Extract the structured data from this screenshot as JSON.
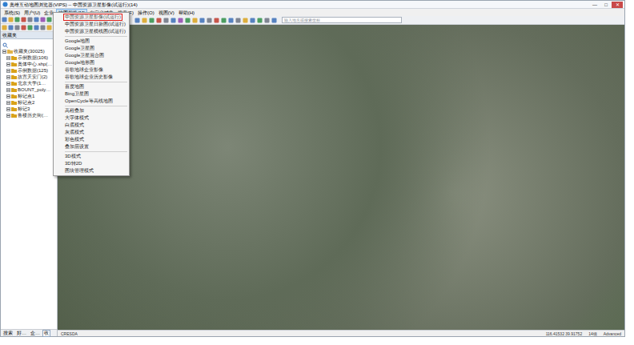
{
  "window": {
    "title": "奥维互动地图浏览器(VIPS) -- 中国资源卫星影像(试运行)(14)",
    "controls": [
      "—",
      "□",
      "✕"
    ]
  },
  "menu_bar": [
    {
      "label": "系统(S)",
      "selected": false
    },
    {
      "label": "用户(U)",
      "selected": false
    },
    {
      "label": "企业",
      "selected": false
    },
    {
      "label": "地图切换(M)",
      "selected": true
    },
    {
      "label": "自定义对象",
      "selected": false
    },
    {
      "label": "搜索(F)",
      "selected": false
    },
    {
      "label": "操作(O)",
      "selected": false
    },
    {
      "label": "视图(V)",
      "selected": false
    },
    {
      "label": "帮助(H)",
      "selected": false
    }
  ],
  "search": {
    "placeholder": "输入地名或搜索坐标"
  },
  "sidebar": {
    "header": "收藏夹",
    "items": [
      {
        "label": "收藏夹(30025)",
        "level": 0,
        "expanded": true
      },
      {
        "label": "示例数据(106)",
        "level": 1,
        "expanded": false
      },
      {
        "label": "奥体中心.shp(…",
        "level": 1,
        "expanded": false
      },
      {
        "label": "示例数据(125)",
        "level": 1,
        "expanded": false
      },
      {
        "label": "故宫天安门(2)",
        "level": 1,
        "expanded": false
      },
      {
        "label": "北京大学(1…",
        "level": 1,
        "expanded": false
      },
      {
        "label": "BOUNT_poly…",
        "level": 1,
        "expanded": false
      },
      {
        "label": "标记点1",
        "level": 1,
        "expanded": false
      },
      {
        "label": "标记点2",
        "level": 1,
        "expanded": false
      },
      {
        "label": "标记3",
        "level": 1,
        "expanded": false
      },
      {
        "label": "鲁楼历史街(…",
        "level": 1,
        "expanded": false
      }
    ],
    "bottom_tabs": [
      {
        "label": "搜索",
        "selected": false
      },
      {
        "label": "好…",
        "selected": false
      },
      {
        "label": "企…",
        "selected": false
      },
      {
        "label": "收",
        "selected": true
      }
    ]
  },
  "dropdown": [
    {
      "kind": "item",
      "label": "中国资源卫星影像(试运行)",
      "selected": true
    },
    {
      "kind": "item",
      "label": "中国资源卫星日新图(试运行)",
      "selected": false
    },
    {
      "kind": "item",
      "label": "中国资源卫星横线图(试运行)",
      "selected": false
    },
    {
      "kind": "separator",
      "label": "",
      "selected": false
    },
    {
      "kind": "item",
      "label": "Google地图",
      "selected": false
    },
    {
      "kind": "item",
      "label": "Google卫星图",
      "selected": false
    },
    {
      "kind": "item",
      "label": "Google卫星混合图",
      "selected": false
    },
    {
      "kind": "item",
      "label": "Google地形图",
      "selected": false
    },
    {
      "kind": "item",
      "label": "谷歌地球企业影像",
      "selected": false
    },
    {
      "kind": "item",
      "label": "谷歌地球企业历史影像",
      "selected": false
    },
    {
      "kind": "separator",
      "label": "",
      "selected": false
    },
    {
      "kind": "item",
      "label": "百度地图",
      "selected": false
    },
    {
      "kind": "item",
      "label": "Bing卫星图",
      "selected": false
    },
    {
      "kind": "item",
      "label": "OpenCycle等高线地图",
      "selected": false
    },
    {
      "kind": "separator",
      "label": "",
      "selected": false
    },
    {
      "kind": "item",
      "label": "高程叠加",
      "selected": false
    },
    {
      "kind": "item",
      "label": "大字体模式",
      "selected": false
    },
    {
      "kind": "item",
      "label": "白底模式",
      "selected": false
    },
    {
      "kind": "item",
      "label": "灰底模式",
      "selected": false
    },
    {
      "kind": "item",
      "label": "彩色模式",
      "selected": false
    },
    {
      "kind": "item",
      "label": "叠加层设置",
      "selected": false
    },
    {
      "kind": "separator",
      "label": "",
      "selected": false
    },
    {
      "kind": "item",
      "label": "3D模式",
      "selected": false
    },
    {
      "kind": "item",
      "label": "3D转2D",
      "selected": false
    },
    {
      "kind": "item",
      "label": "图块管理模式",
      "selected": false
    }
  ],
  "status_bar": [
    "CRESDA",
    "116.41532 39.91752",
    "14级",
    "Advanced"
  ]
}
